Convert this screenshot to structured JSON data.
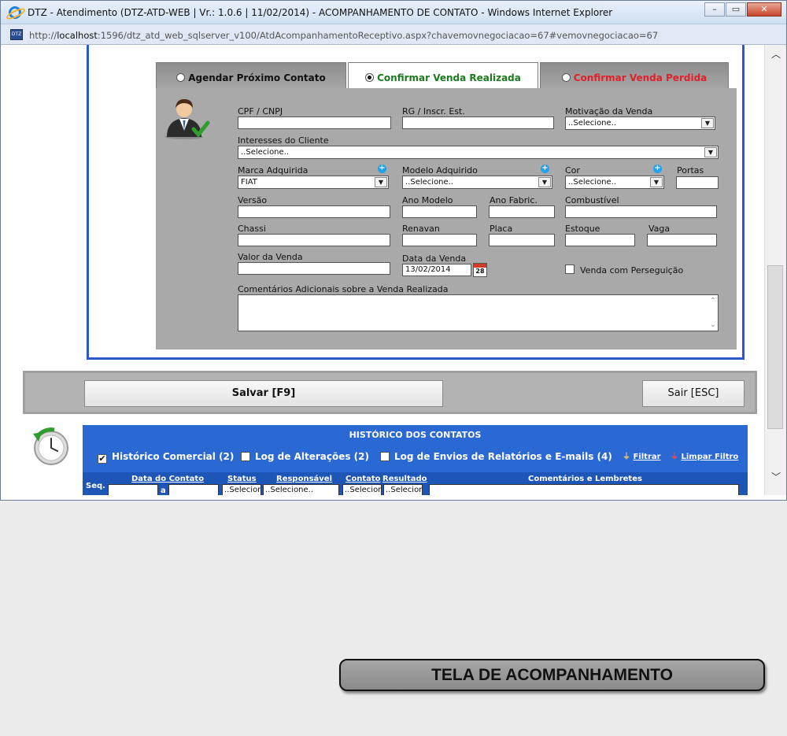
{
  "window": {
    "title": "DTZ - Atendimento (DTZ-ATD-WEB | Vr.: 1.0.6 | 11/02/2014) - ACOMPANHAMENTO DE CONTATO - Windows Internet Explorer",
    "url_prefix": "http://",
    "url_host": "localhost",
    "url_rest": ":1596/dtz_atd_web_sqlserver_v100/AtdAcompanhamentoReceptivo.aspx?chavemovnegociacao=67#vemovnegociacao=67",
    "page_icon_text": "DTZ"
  },
  "tabs": [
    {
      "label": "Agendar Próximo Contato",
      "color": "#111111"
    },
    {
      "label": "Confirmar Venda Realizada",
      "color": "#1d7a1d"
    },
    {
      "label": "Confirmar Venda Perdida",
      "color": "#e0202a"
    }
  ],
  "form": {
    "cpf_label": "CPF / CNPJ",
    "cpf_value": "",
    "rg_label": "RG / Inscr. Est.",
    "rg_value": "",
    "motivacao_label": "Motivação da Venda",
    "motivacao_value": "..Selecione..",
    "interesses_label": "Interesses do Cliente",
    "interesses_value": "..Selecione..",
    "marca_label": "Marca Adquirida",
    "marca_value": "FIAT",
    "modelo_label": "Modelo Adquirido",
    "modelo_value": "..Selecione..",
    "cor_label": "Cor",
    "cor_value": "..Selecione..",
    "portas_label": "Portas",
    "versao_label": "Versão",
    "ano_modelo_label": "Ano Modelo",
    "ano_fabric_label": "Ano Fabric.",
    "combustivel_label": "Combustível",
    "chassi_label": "Chassi",
    "renavan_label": "Renavan",
    "placa_label": "Placa",
    "estoque_label": "Estoque",
    "vaga_label": "Vaga",
    "valor_label": "Valor da Venda",
    "data_label": "Data da Venda",
    "data_value": "13/02/2014",
    "calendar_day": "28",
    "perseguicao_label": "Venda com Perseguição",
    "comentarios_label": "Comentários Adicionais sobre a Venda Realizada"
  },
  "buttons": {
    "save": "Salvar [F9]",
    "exit": "Sair [ESC]"
  },
  "history": {
    "title": "HISTÓRICO DOS CONTATOS",
    "check_comercial": "Histórico Comercial (2)",
    "check_alteracoes": "Log de Alterações (2)",
    "check_envios": "Log de Envios de Relatórios e E-mails (4)",
    "filter": "Filtrar",
    "clear_filter": "Limpar Filtro",
    "columns": {
      "seq": "Seq.",
      "data": "Data do Contato",
      "status": "Status",
      "responsavel": "Responsável",
      "contato": "Contato",
      "resultado": "Resultado",
      "comentarios": "Comentários e Lembretes"
    },
    "date_sep": "a",
    "status_value": "..Selecion",
    "responsavel_value": "..Selecione..",
    "contato_value": "..Selecion",
    "resultado_value": "..Selecion"
  },
  "caption": "TELA DE ACOMPANHAMENTO"
}
